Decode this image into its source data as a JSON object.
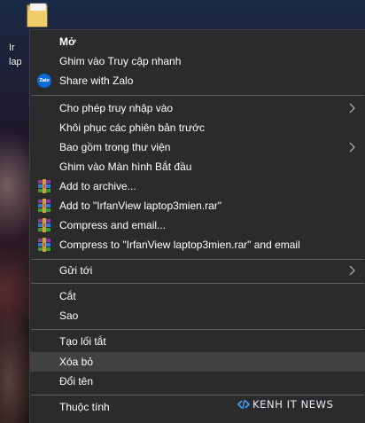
{
  "desktop": {
    "icon": {
      "name": "folder-icon",
      "label_line1": "Ir",
      "label_line2": "lap"
    }
  },
  "menu": {
    "items": [
      {
        "label": "Mở",
        "bold": true,
        "icon": null,
        "submenu": false
      },
      {
        "label": "Ghim vào Truy cập nhanh",
        "icon": null,
        "submenu": false
      },
      {
        "label": "Share with Zalo",
        "icon": "zalo-icon",
        "icon_text": "Zalo",
        "submenu": false
      },
      {
        "label": "Cho phép truy nhập vào",
        "icon": null,
        "submenu": true
      },
      {
        "label": "Khôi phục các phiên bản trước",
        "icon": null,
        "submenu": false
      },
      {
        "label": "Bao gồm trong thư viện",
        "icon": null,
        "submenu": true
      },
      {
        "label": "Ghim vào Màn hình Bắt đầu",
        "icon": null,
        "submenu": false
      },
      {
        "label": "Add to archive...",
        "icon": "winrar-icon",
        "submenu": false
      },
      {
        "label": "Add to \"IrfanView laptop3mien.rar\"",
        "icon": "winrar-icon",
        "submenu": false
      },
      {
        "label": "Compress and email...",
        "icon": "winrar-icon",
        "submenu": false
      },
      {
        "label": "Compress to \"IrfanView laptop3mien.rar\" and email",
        "icon": "winrar-icon",
        "submenu": false
      },
      {
        "label": "Gửi tới",
        "icon": null,
        "submenu": true
      },
      {
        "label": "Cắt",
        "icon": null,
        "submenu": false
      },
      {
        "label": "Sao",
        "icon": null,
        "submenu": false
      },
      {
        "label": "Tạo lối tắt",
        "icon": null,
        "submenu": false
      },
      {
        "label": "Xóa bỏ",
        "icon": null,
        "submenu": false,
        "highlighted": true
      },
      {
        "label": "Đổi tên",
        "icon": null,
        "submenu": false
      },
      {
        "label": "Thuộc tính",
        "icon": null,
        "submenu": false
      }
    ]
  },
  "watermark": {
    "text": "KENH IT NEWS"
  },
  "colors": {
    "menu_bg": "#2b2b2b",
    "menu_highlight": "#414141",
    "separator": "#5e5e5e",
    "zalo_blue": "#0b6bd8"
  }
}
